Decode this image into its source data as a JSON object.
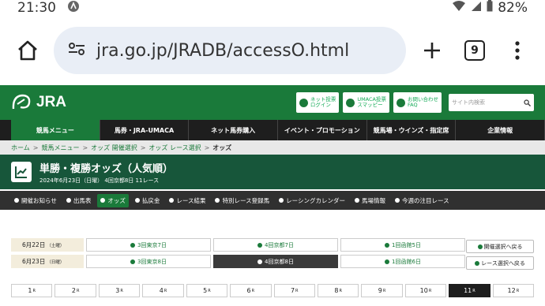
{
  "status": {
    "time": "21:30",
    "battery": "82%"
  },
  "browser": {
    "url": "jra.go.jp/JRADB/accessO.html",
    "tab_count": "9"
  },
  "header": {
    "logo_text": "JRA",
    "buttons": [
      {
        "label": "ネット投票\nログイン"
      },
      {
        "label": "UMACA投票\nスマッピー"
      },
      {
        "label": "お問い合わせ\nFAQ"
      }
    ],
    "search_placeholder": "サイト内検索"
  },
  "global_nav": [
    "競馬メニュー",
    "馬券・JRA-UMACA",
    "ネット馬券購入",
    "イベント・プロモーション",
    "競馬場・ウインズ・指定席",
    "企業情報"
  ],
  "breadcrumb": {
    "items": [
      "ホーム",
      "競馬メニュー",
      "オッズ 開催選択",
      "オッズ レース選択"
    ],
    "current": "オッズ",
    "sep": ">"
  },
  "title": {
    "main": "単勝・複勝オッズ（人気順）",
    "sub": "2024年6月23日（日曜） 4回京都8日 11レース"
  },
  "sub_nav": [
    "開催お知らせ",
    "出馬表",
    "オッズ",
    "払戻金",
    "レース結果",
    "特別レース登録馬",
    "レーシングカレンダー",
    "馬場情報",
    "今週の注目レース"
  ],
  "dates": [
    {
      "date": "6月22日",
      "day": "（土曜）",
      "cells": [
        "3回東京7日",
        "4回京都7日",
        "1回函館5日"
      ]
    },
    {
      "date": "6月23日",
      "day": "（日曜）",
      "cells": [
        "3回東京8日",
        "4回京都8日",
        "1回函館6日"
      ]
    }
  ],
  "side_buttons": [
    "開催選択へ戻る",
    "レース選択へ戻る"
  ],
  "races": [
    "1",
    "2",
    "3",
    "4",
    "5",
    "6",
    "7",
    "8",
    "9",
    "10",
    "11",
    "12"
  ],
  "race_suffix": "R"
}
